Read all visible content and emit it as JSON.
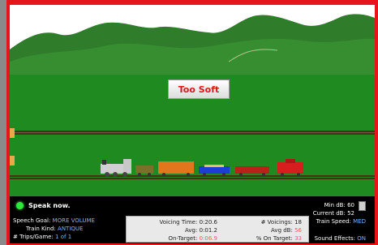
{
  "sign_text": "Too Soft",
  "status": {
    "text": "Speak now.",
    "light_color": "#2ee83a"
  },
  "speech_goal": {
    "label": "Speech Goal:",
    "value": "MORE VOLUME"
  },
  "train_kind": {
    "label": "Train Kind:",
    "value": "ANTIQUE"
  },
  "trips_per_game": {
    "label": "# Trips/Game:",
    "value": "1  of  1"
  },
  "stats": {
    "voicing_time": {
      "label": "Voicing Time:",
      "value": "0:20.6"
    },
    "avg_time": {
      "label": "Avg:",
      "value": "0:01.2"
    },
    "on_target_time": {
      "label": "On-Target:",
      "value": "0:06.9"
    },
    "voicings": {
      "label": "# Voicings:",
      "value": "18"
    },
    "avg_db": {
      "label": "Avg dB:",
      "value": "56"
    },
    "pct_on_target": {
      "label": "% On Target:",
      "value": "33"
    }
  },
  "min_db": {
    "label": "Min dB:",
    "value": "60"
  },
  "current_db": {
    "label": "Current dB:",
    "value": "52"
  },
  "train_speed": {
    "label": "Train Speed:",
    "value": "MED"
  },
  "sound_effects": {
    "label": "Sound Effects:",
    "value": "ON"
  },
  "colors": {
    "frame": "#e8141c",
    "grass": "#1f8a1f",
    "hills": "#2f7d2a",
    "sky": "#ffffff",
    "highlight_value": "#ff5a5a",
    "setting_value": "#7fb2ff"
  }
}
